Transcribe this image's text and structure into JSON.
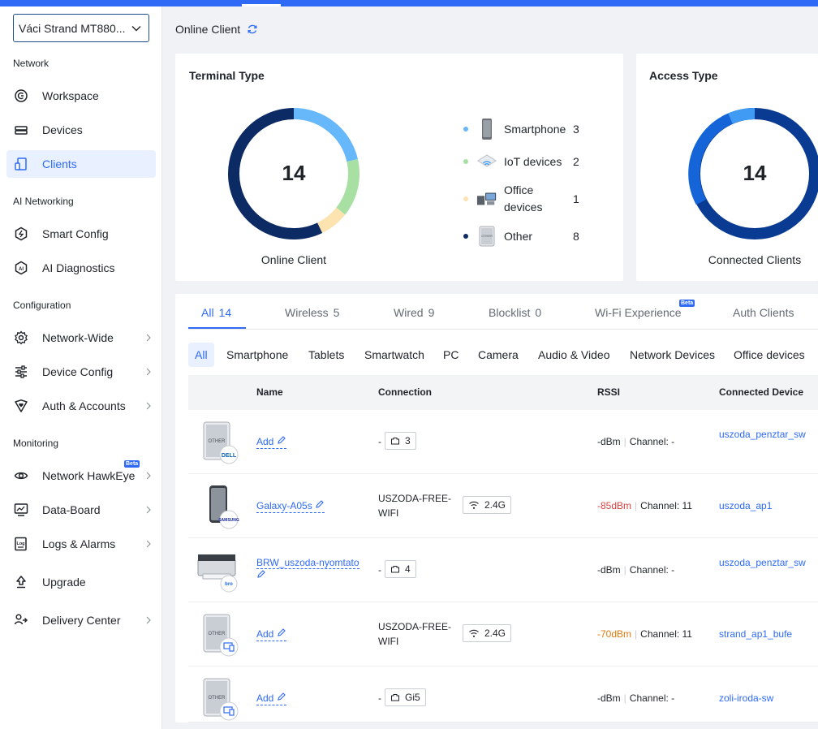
{
  "site_selector": {
    "value": "Váci Strand MT880..."
  },
  "sidebar": {
    "sections": [
      {
        "label": "Network"
      },
      {
        "label": "AI Networking"
      },
      {
        "label": "Configuration"
      },
      {
        "label": "Monitoring"
      }
    ],
    "items": [
      {
        "label": "Workspace",
        "icon": "workspace-icon"
      },
      {
        "label": "Devices",
        "icon": "devices-icon"
      },
      {
        "label": "Clients",
        "icon": "clients-icon",
        "active": true
      },
      {
        "label": "Smart Config",
        "icon": "smart-config-icon"
      },
      {
        "label": "AI Diagnostics",
        "icon": "ai-diagnostics-icon"
      },
      {
        "label": "Network-Wide",
        "icon": "gear-icon"
      },
      {
        "label": "Device Config",
        "icon": "sliders-icon"
      },
      {
        "label": "Auth & Accounts",
        "icon": "shield-heart-icon"
      },
      {
        "label": "Network HawkEye",
        "icon": "eye-icon",
        "badge": "Beta"
      },
      {
        "label": "Data-Board",
        "icon": "monitor-chart-icon"
      },
      {
        "label": "Logs & Alarms",
        "icon": "log-icon"
      },
      {
        "label": "Upgrade",
        "icon": "upgrade-icon"
      },
      {
        "label": "Delivery Center",
        "icon": "delivery-icon"
      }
    ]
  },
  "page": {
    "title": "Online Client"
  },
  "terminal_card": {
    "title": "Terminal Type",
    "total": "14",
    "caption": "Online Client",
    "legend": [
      {
        "label": "Smartphone",
        "count": "3",
        "color": "#66b8fa"
      },
      {
        "label": "IoT devices",
        "count": "2",
        "color": "#a8e0a4"
      },
      {
        "label": "Office devices",
        "count": "1",
        "color": "#fde3b0"
      },
      {
        "label": "Other",
        "count": "8",
        "color": "#0c2a63"
      }
    ]
  },
  "access_card": {
    "title": "Access Type",
    "total": "14",
    "caption": "Connected Clients",
    "colors": {
      "wireless": "#1565d8",
      "wired": "#0a3b92",
      "other": "#3f9bf4"
    }
  },
  "tabs": [
    {
      "label": "All",
      "count": "14",
      "active": true
    },
    {
      "label": "Wireless",
      "count": "5"
    },
    {
      "label": "Wired",
      "count": "9"
    },
    {
      "label": "Blocklist",
      "count": "0"
    },
    {
      "label": "Wi-Fi Experience",
      "count": "",
      "badge": "Beta"
    },
    {
      "label": "Auth Clients",
      "count": ""
    }
  ],
  "filters": [
    "All",
    "Smartphone",
    "Tablets",
    "Smartwatch",
    "PC",
    "Camera",
    "Audio & Video",
    "Network Devices",
    "Office devices"
  ],
  "table": {
    "headers": {
      "name": "Name",
      "connection": "Connection",
      "rssi": "RSSI",
      "connected_device": "Connected Device"
    },
    "rows": [
      {
        "name": "Add",
        "conn_text": "-",
        "port": "3",
        "port_type": "wired",
        "rssi": "-dBm",
        "channel": "Channel: -",
        "device": "uszoda_penztar_sw",
        "thumb": "other-dell"
      },
      {
        "name": "Galaxy-A05s",
        "conn_text": "USZODA-FREE-WIFI",
        "port": "2.4G",
        "port_type": "wifi",
        "rssi": "-85dBm",
        "channel": "Channel: 11",
        "device": "uszoda_ap1",
        "thumb": "phone-samsung"
      },
      {
        "name": "BRW_uszoda-nyomtato",
        "conn_text": "-",
        "port": "4",
        "port_type": "wired",
        "rssi": "-dBm",
        "channel": "Channel: -",
        "device": "uszoda_penztar_sw",
        "thumb": "printer"
      },
      {
        "name": "Add",
        "conn_text": "USZODA-FREE-WIFI",
        "port": "2.4G",
        "port_type": "wifi",
        "rssi": "-70dBm",
        "channel": "Channel: 11",
        "device": "strand_ap1_bufe",
        "thumb": "other"
      },
      {
        "name": "Add",
        "conn_text": "-",
        "port": "Gi5",
        "port_type": "wired",
        "rssi": "-dBm",
        "channel": "Channel: -",
        "device": "zoli-iroda-sw",
        "thumb": "other"
      }
    ]
  }
}
